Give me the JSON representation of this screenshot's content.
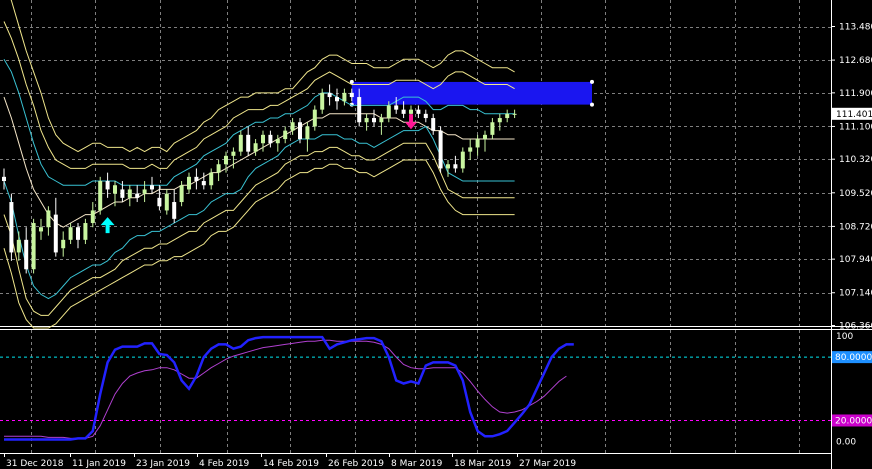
{
  "chart_data": [
    {
      "type": "candlestick",
      "pane": "main",
      "y_ticks": [
        "113.480",
        "112.680",
        "111.900",
        "111.100",
        "110.320",
        "109.520",
        "108.720",
        "107.940",
        "107.140",
        "106.360"
      ],
      "ylim": [
        106.28,
        113.98
      ],
      "current_price": "111.401",
      "x_ticks": [
        "31 Dec 2018",
        "11 Jan 2019",
        "23 Jan 2019",
        "4 Feb 2019",
        "14 Feb 2019",
        "26 Feb 2019",
        "8 Mar 2019",
        "18 Mar 2019",
        "27 Mar 2019"
      ],
      "grid": true,
      "colors": {
        "background": "#000000",
        "grid": "#7f7f7f",
        "candle_bull": "#c8f5a0",
        "candle_bear": "#ffffff",
        "bands_outer": "#f0e68c",
        "bands_mid": "#39c2d3",
        "ma_line": "#f5e6c8",
        "zone": "#1a16f0",
        "buy_arrow": "#00ffff",
        "sell_arrow": "#ff1493"
      },
      "candles": [
        [
          109.9,
          110.1,
          109.6,
          109.8
        ],
        [
          109.3,
          109.5,
          107.9,
          108.1
        ],
        [
          108.1,
          108.6,
          107.9,
          108.4
        ],
        [
          108.4,
          108.7,
          107.6,
          107.7
        ],
        [
          107.7,
          108.9,
          107.6,
          108.8
        ],
        [
          108.6,
          108.9,
          108.4,
          108.7
        ],
        [
          108.7,
          109.2,
          108.5,
          109.1
        ],
        [
          109.0,
          109.4,
          108.0,
          108.1
        ],
        [
          108.2,
          108.6,
          108.0,
          108.4
        ],
        [
          108.4,
          108.8,
          108.3,
          108.7
        ],
        [
          108.7,
          108.8,
          108.2,
          108.4
        ],
        [
          108.4,
          108.9,
          108.3,
          108.8
        ],
        [
          108.8,
          109.3,
          108.7,
          109.1
        ],
        [
          109.1,
          109.9,
          109.0,
          109.8
        ],
        [
          109.8,
          110.0,
          109.4,
          109.6
        ],
        [
          109.5,
          109.8,
          109.2,
          109.7
        ],
        [
          109.6,
          109.8,
          109.3,
          109.4
        ],
        [
          109.4,
          109.7,
          109.2,
          109.6
        ],
        [
          109.5,
          109.7,
          109.3,
          109.4
        ],
        [
          109.5,
          109.8,
          109.3,
          109.6
        ],
        [
          109.7,
          109.9,
          109.5,
          109.6
        ],
        [
          109.4,
          109.7,
          109.1,
          109.2
        ],
        [
          109.1,
          109.6,
          109.0,
          109.5
        ],
        [
          109.3,
          109.6,
          108.8,
          108.9
        ],
        [
          109.3,
          109.8,
          109.2,
          109.7
        ],
        [
          109.6,
          110.0,
          109.5,
          109.9
        ],
        [
          109.9,
          110.1,
          109.6,
          109.8
        ],
        [
          109.8,
          110.0,
          109.6,
          109.7
        ],
        [
          109.7,
          110.1,
          109.6,
          110.0
        ],
        [
          110.0,
          110.3,
          109.8,
          110.2
        ],
        [
          110.2,
          110.5,
          110.0,
          110.4
        ],
        [
          110.4,
          110.6,
          110.1,
          110.5
        ],
        [
          110.5,
          111.0,
          110.4,
          110.9
        ],
        [
          110.9,
          111.1,
          110.4,
          110.5
        ],
        [
          110.5,
          110.8,
          110.4,
          110.7
        ],
        [
          110.7,
          111.0,
          110.5,
          110.9
        ],
        [
          110.9,
          111.0,
          110.6,
          110.7
        ],
        [
          110.7,
          110.9,
          110.5,
          110.8
        ],
        [
          110.8,
          111.1,
          110.7,
          111.0
        ],
        [
          111.0,
          111.3,
          110.9,
          111.2
        ],
        [
          111.2,
          111.3,
          110.7,
          110.8
        ],
        [
          110.8,
          111.2,
          110.5,
          111.1
        ],
        [
          111.1,
          111.6,
          111.0,
          111.5
        ],
        [
          111.5,
          112.0,
          111.4,
          111.9
        ],
        [
          111.9,
          112.1,
          111.6,
          111.8
        ],
        [
          111.8,
          112.0,
          111.5,
          111.7
        ],
        [
          111.7,
          112.0,
          111.6,
          111.9
        ],
        [
          111.9,
          112.0,
          111.7,
          111.8
        ],
        [
          111.8,
          112.0,
          111.1,
          111.2
        ],
        [
          111.2,
          111.4,
          111.0,
          111.3
        ],
        [
          111.3,
          111.5,
          111.1,
          111.2
        ],
        [
          111.2,
          111.4,
          110.9,
          111.3
        ],
        [
          111.3,
          111.7,
          111.2,
          111.6
        ],
        [
          111.6,
          111.8,
          111.4,
          111.5
        ],
        [
          111.5,
          111.7,
          111.3,
          111.4
        ],
        [
          111.4,
          111.6,
          111.2,
          111.5
        ],
        [
          111.5,
          111.6,
          111.3,
          111.4
        ],
        [
          111.4,
          111.5,
          111.2,
          111.3
        ],
        [
          111.3,
          111.4,
          110.9,
          111.0
        ],
        [
          111.0,
          111.1,
          110.0,
          110.1
        ],
        [
          110.1,
          110.3,
          109.9,
          110.2
        ],
        [
          110.2,
          110.4,
          110.0,
          110.1
        ],
        [
          110.1,
          110.6,
          110.0,
          110.5
        ],
        [
          110.5,
          110.8,
          110.3,
          110.6
        ],
        [
          110.6,
          110.9,
          110.4,
          110.8
        ],
        [
          110.8,
          111.0,
          110.5,
          110.9
        ],
        [
          110.9,
          111.3,
          110.8,
          111.2
        ],
        [
          111.2,
          111.4,
          111.0,
          111.3
        ],
        [
          111.3,
          111.5,
          111.2,
          111.4
        ],
        [
          111.4,
          111.5,
          111.3,
          111.4
        ]
      ],
      "upper_outer": [
        114.5,
        114.1,
        113.5,
        112.9,
        112.4,
        111.9,
        111.3,
        110.9,
        110.7,
        110.6,
        110.5,
        110.6,
        110.7,
        110.7,
        110.6,
        110.6,
        110.6,
        110.5,
        110.6,
        110.5,
        110.6,
        110.6,
        110.5,
        110.7,
        110.8,
        110.9,
        111.0,
        111.2,
        111.3,
        111.5,
        111.6,
        111.7,
        111.8,
        111.8,
        111.9,
        111.9,
        111.9,
        111.9,
        112.0,
        112.0,
        112.2,
        112.4,
        112.5,
        112.7,
        112.8,
        112.8,
        112.7,
        112.6,
        112.6,
        112.6,
        112.5,
        112.5,
        112.5,
        112.6,
        112.7,
        112.7,
        112.7,
        112.6,
        112.5,
        112.6,
        112.8,
        112.9,
        112.9,
        112.8,
        112.7,
        112.6,
        112.5,
        112.5,
        112.5,
        112.4
      ],
      "upper_mid": [
        113.6,
        113.2,
        112.7,
        112.1,
        111.6,
        111.0,
        110.6,
        110.3,
        110.2,
        110.1,
        110.1,
        110.1,
        110.2,
        110.2,
        110.2,
        110.2,
        110.2,
        110.1,
        110.1,
        110.1,
        110.2,
        110.1,
        110.1,
        110.3,
        110.4,
        110.5,
        110.6,
        110.8,
        110.9,
        111.0,
        111.1,
        111.3,
        111.4,
        111.5,
        111.5,
        111.5,
        111.6,
        111.6,
        111.7,
        111.8,
        111.9,
        112.0,
        112.2,
        112.3,
        112.4,
        112.3,
        112.2,
        112.1,
        112.1,
        112.1,
        112.1,
        112.1,
        112.1,
        112.2,
        112.2,
        112.2,
        112.2,
        112.1,
        112.0,
        112.1,
        112.3,
        112.4,
        112.4,
        112.3,
        112.2,
        112.1,
        112.1,
        112.1,
        112.1,
        112.0
      ],
      "upper_inner": [
        112.7,
        112.4,
        111.9,
        111.3,
        110.7,
        110.2,
        109.9,
        109.8,
        109.7,
        109.7,
        109.7,
        109.7,
        109.8,
        109.8,
        109.8,
        109.8,
        109.7,
        109.7,
        109.7,
        109.7,
        109.7,
        109.7,
        109.7,
        109.9,
        110.0,
        110.1,
        110.2,
        110.4,
        110.5,
        110.6,
        110.7,
        110.9,
        111.0,
        111.1,
        111.2,
        111.2,
        111.3,
        111.3,
        111.4,
        111.4,
        111.5,
        111.6,
        111.8,
        111.9,
        111.9,
        111.8,
        111.7,
        111.6,
        111.6,
        111.6,
        111.6,
        111.6,
        111.6,
        111.7,
        111.8,
        111.8,
        111.8,
        111.7,
        111.5,
        111.5,
        111.6,
        111.6,
        111.6,
        111.5,
        111.5,
        111.4,
        111.4,
        111.4,
        111.4,
        111.4
      ],
      "ma_line": [
        111.8,
        111.3,
        110.7,
        110.1,
        109.6,
        109.3,
        109.0,
        108.8,
        108.7,
        108.8,
        108.9,
        109.0,
        109.0,
        109.1,
        109.2,
        109.3,
        109.3,
        109.4,
        109.4,
        109.5,
        109.5,
        109.6,
        109.6,
        109.6,
        109.7,
        109.7,
        109.8,
        109.9,
        110.0,
        110.0,
        110.1,
        110.2,
        110.3,
        110.4,
        110.5,
        110.6,
        110.7,
        110.8,
        110.9,
        111.0,
        111.1,
        111.2,
        111.3,
        111.3,
        111.4,
        111.4,
        111.4,
        111.4,
        111.4,
        111.4,
        111.4,
        111.3,
        111.3,
        111.3,
        111.2,
        111.2,
        111.2,
        111.1,
        111.0,
        111.0,
        110.9,
        110.9,
        110.8,
        110.8,
        110.8,
        110.8,
        110.8,
        110.8,
        110.8,
        110.8
      ],
      "lower_inner": [
        109.8,
        109.3,
        108.5,
        107.8,
        107.3,
        107.1,
        107.0,
        107.1,
        107.3,
        107.5,
        107.6,
        107.7,
        107.8,
        107.8,
        107.9,
        108.1,
        108.2,
        108.4,
        108.5,
        108.5,
        108.6,
        108.6,
        108.7,
        108.8,
        108.9,
        109.0,
        109.0,
        109.1,
        109.3,
        109.4,
        109.5,
        109.5,
        109.6,
        109.9,
        110.1,
        110.2,
        110.3,
        110.4,
        110.6,
        110.7,
        110.8,
        110.8,
        110.8,
        110.9,
        110.9,
        110.9,
        110.8,
        110.8,
        110.7,
        110.7,
        110.6,
        110.7,
        110.8,
        110.9,
        111.0,
        111.0,
        111.0,
        111.1,
        110.8,
        110.4,
        110.0,
        109.9,
        109.8,
        109.8,
        109.8,
        109.8,
        109.8,
        109.8,
        109.8,
        109.8
      ],
      "lower_mid": [
        109.0,
        108.5,
        107.7,
        107.0,
        106.7,
        106.6,
        106.6,
        106.8,
        107.0,
        107.2,
        107.3,
        107.4,
        107.5,
        107.5,
        107.6,
        107.7,
        107.9,
        108.0,
        108.1,
        108.2,
        108.2,
        108.3,
        108.3,
        108.4,
        108.5,
        108.6,
        108.6,
        108.8,
        108.9,
        109.0,
        109.1,
        109.1,
        109.3,
        109.5,
        109.7,
        109.8,
        109.9,
        110.0,
        110.2,
        110.3,
        110.4,
        110.4,
        110.5,
        110.5,
        110.6,
        110.6,
        110.5,
        110.4,
        110.4,
        110.3,
        110.3,
        110.4,
        110.5,
        110.6,
        110.7,
        110.7,
        110.7,
        110.7,
        110.4,
        110.0,
        109.6,
        109.5,
        109.4,
        109.4,
        109.4,
        109.4,
        109.4,
        109.4,
        109.4,
        109.4
      ],
      "lower_outer": [
        108.2,
        107.6,
        106.9,
        106.5,
        106.3,
        106.3,
        106.3,
        106.4,
        106.6,
        106.8,
        106.9,
        107.0,
        107.1,
        107.2,
        107.3,
        107.4,
        107.5,
        107.6,
        107.7,
        107.8,
        107.8,
        107.9,
        107.9,
        108.0,
        108.0,
        108.1,
        108.2,
        108.3,
        108.5,
        108.6,
        108.6,
        108.7,
        108.9,
        109.1,
        109.3,
        109.4,
        109.5,
        109.6,
        109.8,
        109.9,
        110.0,
        110.0,
        110.1,
        110.1,
        110.2,
        110.2,
        110.1,
        110.1,
        110.0,
        110.0,
        109.9,
        110.0,
        110.1,
        110.2,
        110.3,
        110.3,
        110.3,
        110.3,
        110.0,
        109.6,
        109.3,
        109.1,
        109.0,
        109.0,
        109.0,
        109.0,
        109.0,
        109.0,
        109.0,
        109.0
      ],
      "zone": {
        "price_high": 112.16,
        "price_low": 111.62,
        "start_index": 47,
        "end_index": 80
      },
      "buy_signal": {
        "index": 14,
        "price": 108.75
      },
      "sell_signal": {
        "index": 55,
        "price": 111.2
      }
    },
    {
      "type": "line",
      "pane": "oscillator",
      "ylim": [
        0,
        100
      ],
      "y_ticks": [
        "100",
        "80.0000",
        "20.0000",
        "0.00"
      ],
      "levels": [
        80,
        20
      ],
      "colors": {
        "main_line": "#2222ff",
        "signal_line": "#b040d0",
        "level_high": "#00e5ee",
        "level_low": "#ff00ff"
      },
      "series": [
        {
          "values": [
            2,
            2,
            2,
            2,
            2,
            2,
            2,
            2,
            2,
            2,
            3,
            3,
            10,
            45,
            75,
            87,
            90,
            90,
            90,
            93,
            93,
            83,
            82,
            75,
            58,
            50,
            62,
            80,
            88,
            92,
            92,
            88,
            90,
            96,
            98,
            99,
            99,
            99,
            99,
            99,
            99,
            99,
            99,
            99,
            88,
            92,
            94,
            96,
            97,
            98,
            98,
            95,
            80,
            58,
            55,
            57,
            55,
            72,
            75,
            75,
            75,
            72,
            58,
            28,
            10,
            5,
            5,
            7,
            10,
            18,
            26,
            35,
            50,
            65,
            80,
            88,
            92,
            92
          ]
        },
        {
          "values": [
            5,
            5,
            5,
            5,
            5,
            5,
            4,
            4,
            4,
            3,
            3,
            3,
            5,
            15,
            30,
            45,
            55,
            62,
            65,
            67,
            68,
            70,
            70,
            68,
            64,
            60,
            60,
            65,
            70,
            74,
            78,
            81,
            83,
            85,
            87,
            89,
            90,
            91,
            92,
            93,
            94,
            95,
            95,
            96,
            96,
            95,
            95,
            95,
            95,
            95,
            94,
            92,
            88,
            80,
            73,
            70,
            69,
            69,
            70,
            70,
            70,
            70,
            65,
            57,
            48,
            40,
            33,
            28,
            27,
            28,
            30,
            34,
            38,
            43,
            50,
            57,
            62
          ]
        }
      ]
    }
  ]
}
